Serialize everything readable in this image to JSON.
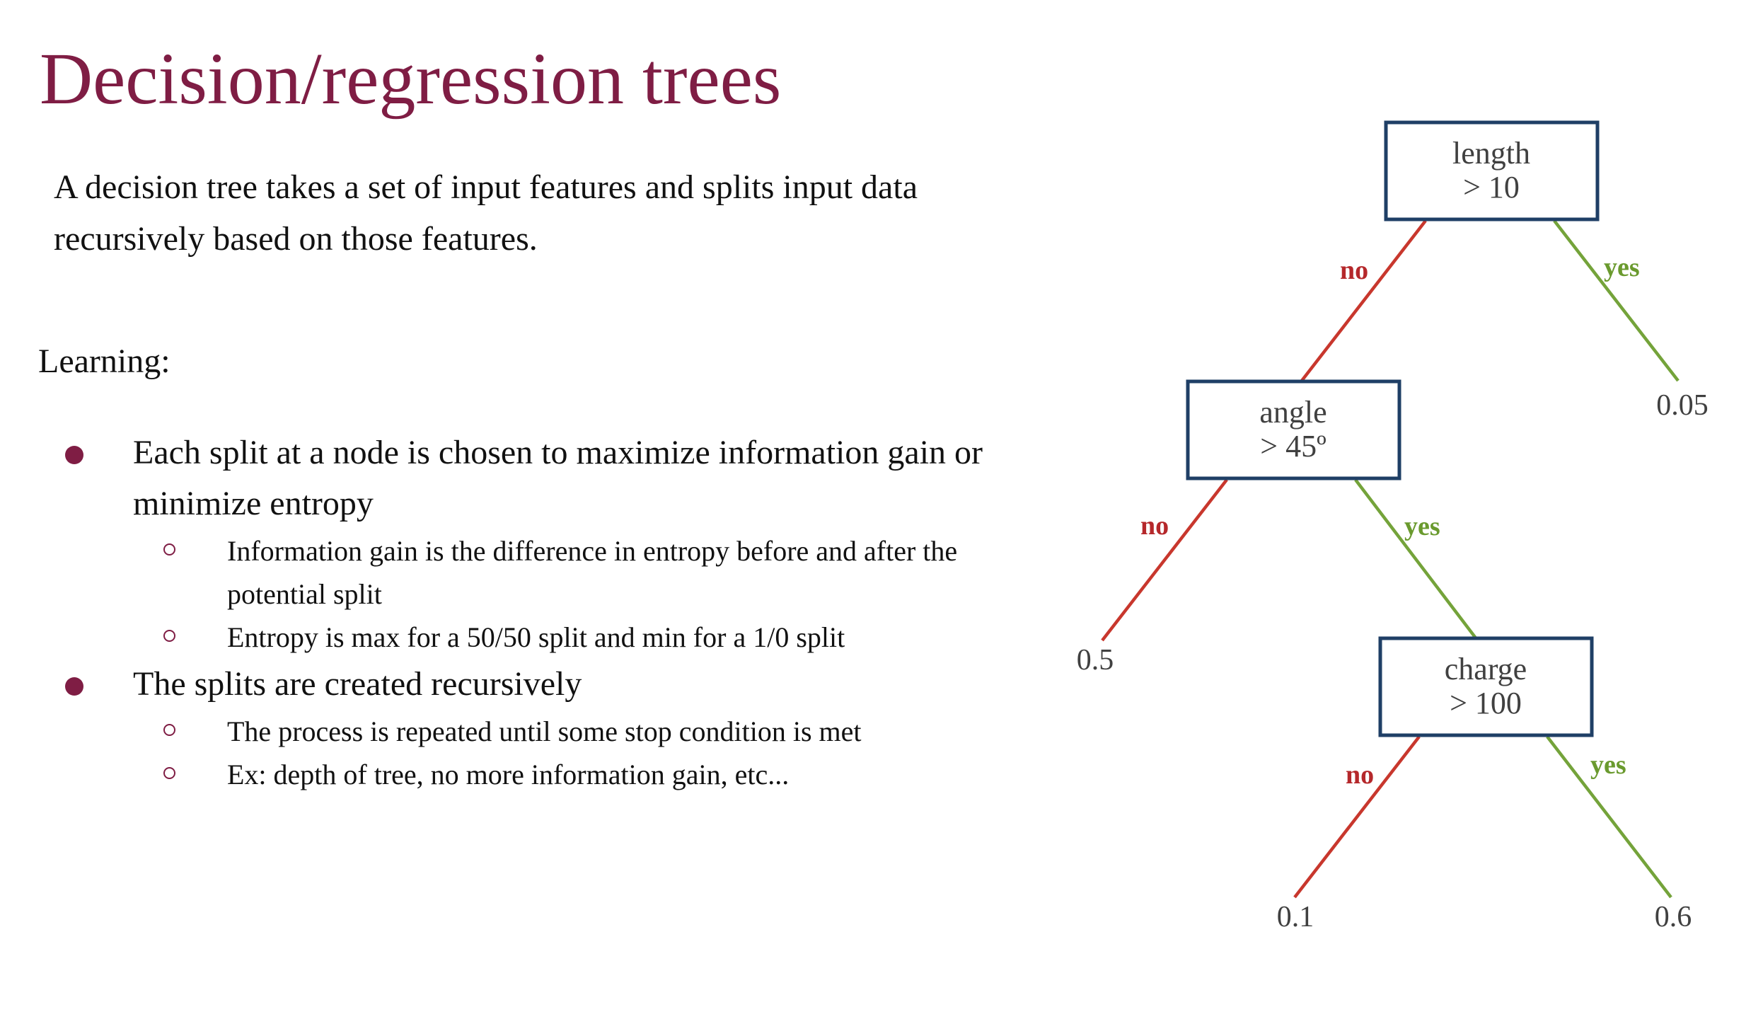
{
  "slide": {
    "title": "Decision/regression trees",
    "intro": "A decision tree takes a set of input features and splits input data recursively based on those features.",
    "learning_label": "Learning:",
    "bullets": [
      {
        "text": "Each split at a node is chosen to maximize information gain or minimize entropy",
        "sub": [
          "Information gain is the difference in entropy before and after the potential split",
          "Entropy is max for a 50/50 split and min for a 1/0 split"
        ]
      },
      {
        "text": "The splits are created recursively",
        "sub": [
          "The process is repeated until some stop condition is met",
          "Ex: depth of tree, no more information gain, etc..."
        ]
      }
    ]
  },
  "tree": {
    "nodes": {
      "length": {
        "line1": "length",
        "line2": "> 10"
      },
      "angle": {
        "line1": "angle",
        "line2": "> 45º"
      },
      "charge": {
        "line1": "charge",
        "line2": "> 100"
      }
    },
    "leaves": {
      "length_yes": "0.05",
      "angle_no": "0.5",
      "charge_no": "0.1",
      "charge_yes": "0.6"
    },
    "edge_labels": {
      "no": "no",
      "yes": "yes"
    }
  },
  "colors": {
    "title": "#7f1d44",
    "bullet": "#7f1d44",
    "node_border": "#1f3f66",
    "edge_no": "#c8372d",
    "edge_yes": "#74a33a",
    "label_no": "#b5282b",
    "label_yes": "#6a9a2e"
  }
}
